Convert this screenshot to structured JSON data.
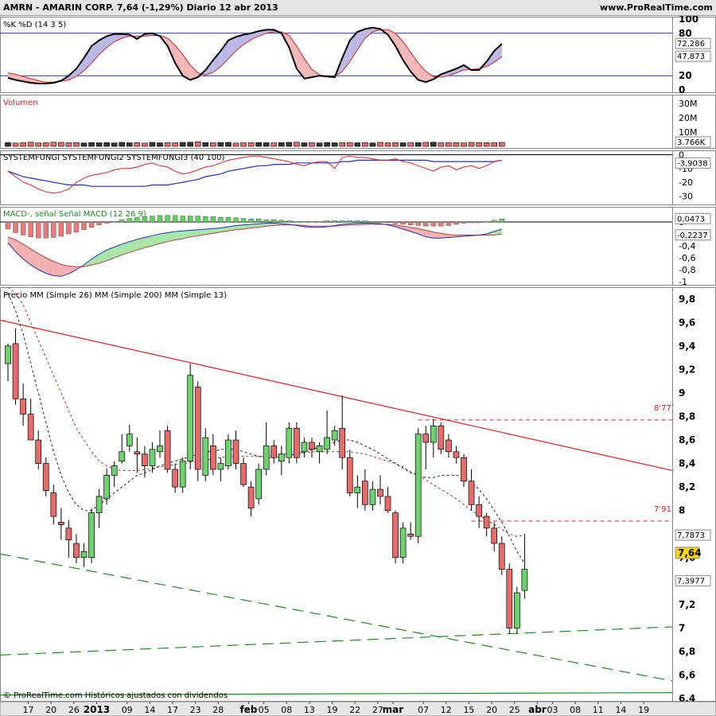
{
  "header": {
    "title": "AMRN - AMARIN CORP.    7,64 (-1,29%)    Diario  12 abr 2013",
    "site": "www.ProRealTime.com"
  },
  "footer": "© ProRealTime.com  Históricos ajustados con dividendos",
  "colors": {
    "up": "#6ed36e",
    "down": "#e66b6b",
    "red": "#e02020",
    "blue": "#2030c0",
    "green": "#1e8c1e",
    "black": "#000000"
  },
  "chart_data": [
    {
      "type": "line",
      "title": "%K %D (14 3 5)",
      "series_names": [
        "%K",
        "%D (14 3 5)"
      ],
      "ylim": [
        0,
        100
      ],
      "ticks": [
        "100",
        "80",
        "20",
        "0"
      ],
      "levels": [
        80,
        20
      ],
      "last_labels": [
        "72,286",
        "47,873"
      ],
      "k": [
        17,
        14,
        12,
        10,
        9,
        9,
        10,
        13,
        20,
        30,
        45,
        62,
        70,
        76,
        79,
        79,
        78,
        72,
        79,
        80,
        76,
        62,
        38,
        20,
        14,
        18,
        28,
        42,
        55,
        70,
        75,
        78,
        80,
        83,
        85,
        85,
        80,
        60,
        30,
        16,
        18,
        20,
        19,
        18,
        45,
        70,
        82,
        86,
        88,
        86,
        78,
        62,
        42,
        26,
        14,
        11,
        15,
        22,
        26,
        30,
        35,
        28,
        28,
        40,
        55,
        65
      ],
      "d": [
        24,
        22,
        19,
        16,
        13,
        11,
        11,
        12,
        14,
        19,
        27,
        38,
        50,
        60,
        68,
        73,
        76,
        76,
        76,
        77,
        77,
        73,
        63,
        50,
        35,
        24,
        21,
        25,
        33,
        44,
        55,
        64,
        71,
        76,
        80,
        82,
        82,
        77,
        62,
        44,
        29,
        21,
        19,
        19,
        26,
        40,
        57,
        73,
        82,
        85,
        85,
        80,
        68,
        53,
        38,
        26,
        19,
        18,
        20,
        24,
        28,
        29,
        30,
        33,
        39,
        47
      ]
    },
    {
      "type": "bar",
      "title": "Volumen",
      "ylim": [
        0,
        35000
      ],
      "ticks": [
        "30M",
        "20M",
        "10M"
      ],
      "last_label": "3.766K",
      "values": [
        2600,
        2300,
        2500,
        2900,
        2400,
        2500,
        2900,
        2800,
        2500,
        2600,
        2400,
        2700,
        2500,
        2600,
        2400,
        2800,
        2500,
        2600,
        2300,
        2800,
        2500,
        2600,
        2500,
        2800,
        2900,
        3200,
        2600,
        2500,
        2700,
        2800,
        2300,
        2500,
        2600,
        2700,
        2500,
        2400,
        2600,
        2800,
        2900,
        2500,
        2600,
        2400,
        2700,
        2500,
        2600,
        2700,
        2500,
        2600,
        2400,
        2800,
        2500,
        2600,
        2500,
        2700,
        2600,
        2800,
        2900,
        2500,
        2700,
        2600,
        2400,
        2800,
        2700,
        2600,
        2500,
        2800
      ]
    },
    {
      "type": "line",
      "title": "SYSTEMFUNGI SYSTEMFUNGI2 SYSTEMFUNGI3 (40 100)",
      "series_names": [
        "SYSTEMFUNGI",
        "SYSTEMFUNGI2",
        "SYSTEMFUNGI3 (40 100)"
      ],
      "ylim": [
        -35,
        2
      ],
      "ticks": [
        "0",
        "-10",
        "-20",
        "-30"
      ],
      "last_label": "-3,9038",
      "red": [
        -12,
        -16,
        -20,
        -22,
        -25,
        -27,
        -28,
        -27,
        -25,
        -20,
        -17,
        -15,
        -14,
        -13,
        -11,
        -10,
        -10,
        -9,
        -7,
        -6,
        -8,
        -9,
        -12,
        -14,
        -13,
        -11,
        -9,
        -8,
        -6,
        -4,
        -3,
        -2,
        -1,
        -1,
        -2,
        -3,
        -4,
        -5,
        -7,
        -8,
        -6,
        -5,
        -5,
        -10,
        -2,
        -1,
        -2,
        -2,
        -3,
        -4,
        -4,
        -3,
        -5,
        -6,
        -8,
        -10,
        -12,
        -9,
        -8,
        -11,
        -9,
        -8,
        -10,
        -8,
        -5,
        -4
      ],
      "blue": [
        -12,
        -14,
        -16,
        -17,
        -18,
        -19,
        -20,
        -21,
        -22,
        -22,
        -22,
        -23,
        -23,
        -23,
        -23,
        -23,
        -23,
        -23,
        -23,
        -22,
        -22,
        -22,
        -21,
        -20,
        -19,
        -18,
        -16,
        -15,
        -14,
        -12,
        -11,
        -10,
        -9,
        -8,
        -8,
        -7,
        -7,
        -7,
        -6,
        -6,
        -6,
        -6,
        -6,
        -6,
        -5,
        -5,
        -4,
        -4,
        -4,
        -4,
        -4,
        -4,
        -4,
        -4,
        -4,
        -4,
        -5,
        -5,
        -5,
        -5,
        -5,
        -5,
        -5,
        -5,
        -5,
        -4
      ]
    },
    {
      "type": "bar",
      "title": "MACD-, señal Señal MACD (12 26 9)",
      "series_names": [
        "MACD",
        "Señal MACD (12 26 9)"
      ],
      "ylim": [
        -1.0,
        0.2
      ],
      "ticks": [
        "0",
        "-0,2",
        "-0,4",
        "-0,6",
        "-0,8",
        "-1"
      ],
      "last_labels": [
        "0,0473",
        "-0,2237"
      ],
      "macd": [
        -0.35,
        -0.5,
        -0.62,
        -0.72,
        -0.8,
        -0.86,
        -0.9,
        -0.91,
        -0.87,
        -0.8,
        -0.72,
        -0.62,
        -0.54,
        -0.47,
        -0.42,
        -0.37,
        -0.33,
        -0.29,
        -0.26,
        -0.23,
        -0.2,
        -0.18,
        -0.16,
        -0.15,
        -0.14,
        -0.13,
        -0.12,
        -0.11,
        -0.1,
        -0.08,
        -0.06,
        -0.05,
        -0.04,
        -0.03,
        -0.02,
        -0.02,
        -0.03,
        -0.04,
        -0.06,
        -0.08,
        -0.09,
        -0.09,
        -0.08,
        -0.06,
        -0.04,
        -0.03,
        -0.02,
        -0.02,
        -0.02,
        -0.03,
        -0.05,
        -0.08,
        -0.12,
        -0.16,
        -0.2,
        -0.25,
        -0.27,
        -0.27,
        -0.26,
        -0.25,
        -0.24,
        -0.23,
        -0.22,
        -0.2,
        -0.16,
        -0.12
      ],
      "signal": [
        -0.25,
        -0.3,
        -0.37,
        -0.45,
        -0.53,
        -0.6,
        -0.66,
        -0.71,
        -0.74,
        -0.75,
        -0.75,
        -0.72,
        -0.69,
        -0.65,
        -0.6,
        -0.55,
        -0.51,
        -0.47,
        -0.43,
        -0.4,
        -0.36,
        -0.33,
        -0.3,
        -0.28,
        -0.25,
        -0.23,
        -0.21,
        -0.19,
        -0.17,
        -0.15,
        -0.13,
        -0.12,
        -0.1,
        -0.09,
        -0.07,
        -0.06,
        -0.05,
        -0.05,
        -0.05,
        -0.06,
        -0.07,
        -0.07,
        -0.07,
        -0.07,
        -0.06,
        -0.05,
        -0.05,
        -0.04,
        -0.04,
        -0.04,
        -0.04,
        -0.05,
        -0.07,
        -0.09,
        -0.11,
        -0.14,
        -0.17,
        -0.19,
        -0.21,
        -0.22,
        -0.22,
        -0.22,
        -0.22,
        -0.22,
        -0.22,
        -0.2
      ],
      "hist": [
        -0.12,
        -0.18,
        -0.22,
        -0.25,
        -0.27,
        -0.27,
        -0.26,
        -0.24,
        -0.2,
        -0.17,
        -0.13,
        -0.09,
        -0.05,
        -0.02,
        0.01,
        0.04,
        0.06,
        0.08,
        0.09,
        0.1,
        0.11,
        0.11,
        0.11,
        0.1,
        0.1,
        0.1,
        0.09,
        0.09,
        0.08,
        0.08,
        0.07,
        0.06,
        0.05,
        0.05,
        0.04,
        0.04,
        0.03,
        0.02,
        0.01,
        0.01,
        0.01,
        0.01,
        0.02,
        0.02,
        0.02,
        0.02,
        0.02,
        0.02,
        0.01,
        0.0,
        -0.01,
        -0.03,
        -0.04,
        -0.05,
        -0.06,
        -0.07,
        -0.07,
        -0.07,
        -0.06,
        -0.04,
        -0.02,
        -0.01,
        0.0,
        0.01,
        0.03,
        0.05
      ]
    },
    {
      "type": "candlestick",
      "title": "Precio MM (Simple 26) MM (Simple 200) MM (Simple 13)",
      "series_names": [
        "MM (Simple 26)",
        "MM (Simple 200)",
        "MM (Simple 13)"
      ],
      "ylim": [
        6.38,
        9.9
      ],
      "ticks": [
        "9,8",
        "9,6",
        "9,4",
        "9,2",
        "9",
        "8,8",
        "8,6",
        "8,4",
        "8,2",
        "8",
        "7,8",
        "7,6",
        "7,4",
        "7,2",
        "7",
        "6,8",
        "6,6",
        "6,4"
      ],
      "last_close": "7,64",
      "level_labels": {
        "ma26": "7,7873",
        "ma13": "7,3977"
      },
      "resistance": [
        {
          "value": 8.77,
          "label": "8'77"
        },
        {
          "value": 7.91,
          "label": "7'91"
        }
      ],
      "ohlc": [
        [
          9.25,
          9.42,
          9.1,
          9.4
        ],
        [
          9.42,
          9.55,
          8.9,
          8.95
        ],
        [
          8.95,
          9.08,
          8.72,
          8.82
        ],
        [
          8.82,
          8.95,
          8.6,
          8.6
        ],
        [
          8.6,
          8.68,
          8.35,
          8.4
        ],
        [
          8.4,
          8.45,
          8.12,
          8.17
        ],
        [
          8.15,
          8.22,
          7.88,
          7.95
        ],
        [
          7.9,
          8.02,
          7.75,
          7.88
        ],
        [
          7.85,
          7.92,
          7.6,
          7.75
        ],
        [
          7.72,
          7.8,
          7.55,
          7.6
        ],
        [
          7.6,
          7.72,
          7.52,
          7.65
        ],
        [
          7.6,
          8.02,
          7.55,
          7.98
        ],
        [
          7.98,
          8.18,
          7.85,
          8.12
        ],
        [
          8.1,
          8.36,
          8.05,
          8.3
        ],
        [
          8.3,
          8.42,
          8.2,
          8.38
        ],
        [
          8.42,
          8.65,
          8.4,
          8.5
        ],
        [
          8.55,
          8.73,
          8.5,
          8.65
        ],
        [
          8.5,
          8.62,
          8.32,
          8.48
        ],
        [
          8.48,
          8.55,
          8.28,
          8.38
        ],
        [
          8.38,
          8.58,
          8.32,
          8.52
        ],
        [
          8.5,
          8.68,
          8.45,
          8.55
        ],
        [
          8.68,
          8.72,
          8.32,
          8.35
        ],
        [
          8.35,
          8.4,
          8.15,
          8.2
        ],
        [
          8.2,
          8.45,
          8.15,
          8.42
        ],
        [
          8.42,
          9.25,
          8.35,
          9.15
        ],
        [
          9.05,
          9.1,
          8.25,
          8.35
        ],
        [
          8.3,
          8.7,
          8.25,
          8.62
        ],
        [
          8.55,
          8.65,
          8.3,
          8.35
        ],
        [
          8.35,
          8.45,
          8.25,
          8.4
        ],
        [
          8.38,
          8.65,
          8.35,
          8.6
        ],
        [
          8.6,
          8.68,
          8.35,
          8.4
        ],
        [
          8.4,
          8.45,
          8.2,
          8.22
        ],
        [
          8.2,
          8.25,
          7.95,
          8.02
        ],
        [
          8.1,
          8.4,
          8.05,
          8.35
        ],
        [
          8.35,
          8.75,
          8.3,
          8.55
        ],
        [
          8.55,
          8.6,
          8.4,
          8.45
        ],
        [
          8.42,
          8.55,
          8.3,
          8.48
        ],
        [
          8.45,
          8.75,
          8.4,
          8.7
        ],
        [
          8.7,
          8.75,
          8.4,
          8.45
        ],
        [
          8.5,
          8.62,
          8.45,
          8.58
        ],
        [
          8.58,
          8.62,
          8.45,
          8.52
        ],
        [
          8.5,
          8.58,
          8.4,
          8.55
        ],
        [
          8.52,
          8.85,
          8.48,
          8.62
        ],
        [
          8.6,
          8.72,
          8.55,
          8.68
        ],
        [
          8.7,
          8.98,
          8.35,
          8.45
        ],
        [
          8.45,
          8.52,
          8.12,
          8.15
        ],
        [
          8.15,
          8.3,
          8.02,
          8.2
        ],
        [
          8.25,
          8.35,
          8.0,
          8.05
        ],
        [
          8.05,
          8.25,
          8.0,
          8.18
        ],
        [
          8.18,
          8.3,
          8.05,
          8.12
        ],
        [
          8.12,
          8.2,
          7.98,
          8.0
        ],
        [
          7.98,
          8.0,
          7.55,
          7.6
        ],
        [
          7.6,
          7.9,
          7.55,
          7.85
        ],
        [
          7.8,
          7.9,
          7.75,
          7.78
        ],
        [
          7.78,
          8.7,
          7.72,
          8.65
        ],
        [
          8.65,
          8.72,
          8.35,
          8.58
        ],
        [
          8.58,
          8.78,
          8.45,
          8.72
        ],
        [
          8.72,
          8.75,
          8.48,
          8.52
        ],
        [
          8.6,
          8.65,
          8.45,
          8.5
        ],
        [
          8.5,
          8.55,
          8.4,
          8.45
        ],
        [
          8.45,
          8.48,
          8.2,
          8.25
        ],
        [
          8.25,
          8.35,
          8.0,
          8.05
        ],
        [
          8.05,
          8.12,
          7.85,
          7.95
        ],
        [
          7.95,
          7.98,
          7.78,
          7.85
        ],
        [
          7.85,
          7.9,
          7.65,
          7.72
        ],
        [
          7.72,
          7.78,
          7.45,
          7.5
        ],
        [
          7.5,
          7.55,
          6.95,
          7.0
        ],
        [
          7.0,
          7.35,
          6.95,
          7.3
        ],
        [
          7.32,
          7.8,
          7.25,
          7.5
        ]
      ],
      "ma13": [
        9.85,
        9.7,
        9.5,
        9.25,
        9.0,
        8.75,
        8.5,
        8.3,
        8.15,
        8.05,
        8.0,
        8.0,
        8.05,
        8.1,
        8.15,
        8.2,
        8.25,
        8.3,
        8.32,
        8.35,
        8.38,
        8.4,
        8.42,
        8.44,
        8.46,
        8.48,
        8.5,
        8.5,
        8.52,
        8.52,
        8.52,
        8.5,
        8.48,
        8.46,
        8.45,
        8.45,
        8.46,
        8.47,
        8.48,
        8.5,
        8.52,
        8.54,
        8.56,
        8.58,
        8.6,
        8.6,
        8.58,
        8.55,
        8.52,
        8.48,
        8.44,
        8.4,
        8.36,
        8.32,
        8.3,
        8.28,
        8.28,
        8.3,
        8.3,
        8.3,
        8.28,
        8.24,
        8.18,
        8.1,
        8.0,
        7.9,
        7.78,
        7.65,
        7.55
      ],
      "ma26": [
        9.9,
        9.85,
        9.75,
        9.6,
        9.45,
        9.3,
        9.15,
        9.0,
        8.85,
        8.7,
        8.6,
        8.5,
        8.42,
        8.38,
        8.35,
        8.34,
        8.34,
        8.34,
        8.35,
        8.36,
        8.37,
        8.38,
        8.39,
        8.4,
        8.41,
        8.42,
        8.43,
        8.44,
        8.45,
        8.46,
        8.46,
        8.46,
        8.46,
        8.46,
        8.46,
        8.47,
        8.48,
        8.48,
        8.49,
        8.49,
        8.5,
        8.5,
        8.5,
        8.5,
        8.5,
        8.5,
        8.49,
        8.48,
        8.46,
        8.44,
        8.42,
        8.4,
        8.37,
        8.33,
        8.3,
        8.26,
        8.22,
        8.18,
        8.14,
        8.1,
        8.05,
        8.0,
        7.96,
        7.92,
        7.88,
        7.84,
        7.8,
        7.78,
        7.79
      ],
      "x_labels": [
        {
          "i": 1,
          "t": "17"
        },
        {
          "i": 4,
          "t": "20"
        },
        {
          "i": 7,
          "t": "26"
        },
        {
          "i": 10,
          "t": "2013",
          "bold": true
        },
        {
          "i": 14,
          "t": "09"
        },
        {
          "i": 17,
          "t": "14"
        },
        {
          "i": 20,
          "t": "17"
        },
        {
          "i": 23,
          "t": "23"
        },
        {
          "i": 26,
          "t": "28"
        },
        {
          "i": 30,
          "t": "feb",
          "bold": true
        },
        {
          "i": 32,
          "t": "05"
        },
        {
          "i": 35,
          "t": "08"
        },
        {
          "i": 38,
          "t": "13"
        },
        {
          "i": 41,
          "t": "19"
        },
        {
          "i": 44,
          "t": "22"
        },
        {
          "i": 47,
          "t": "27"
        },
        {
          "i": 49,
          "t": "mar",
          "bold": true
        },
        {
          "i": 53,
          "t": "07"
        },
        {
          "i": 56,
          "t": "12"
        },
        {
          "i": 59,
          "t": "15"
        },
        {
          "i": 62,
          "t": "20"
        },
        {
          "i": 65,
          "t": "25"
        },
        {
          "i": 68,
          "t": "abr",
          "bold": true
        },
        {
          "i": 70,
          "t": "03"
        },
        {
          "i": 73,
          "t": "08"
        },
        {
          "i": 76,
          "t": "11"
        },
        {
          "i": 79,
          "t": "14"
        },
        {
          "i": 82,
          "t": "19"
        }
      ]
    }
  ]
}
